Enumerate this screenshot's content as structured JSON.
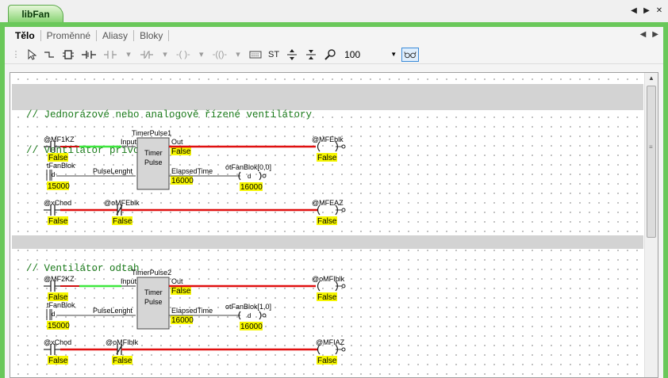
{
  "window": {
    "doc_tab": "libFan",
    "controls": [
      "◀",
      "▶",
      "✕"
    ]
  },
  "subtabs": [
    "Tělo",
    "Proměnné",
    "Aliasy",
    "Bloky"
  ],
  "subtab_arrows": [
    "◀",
    "▶"
  ],
  "toolbar": {
    "st_label": "ST",
    "zoom_value": "100"
  },
  "comments": {
    "block1_line1": "// Jednorázové nebo analogově řízené ventilátory",
    "block1_line2": "// Ventilátor přívodní",
    "block2_line1": "// Ventilátor odtah"
  },
  "rungs": {
    "r1": {
      "block_name": "TimerPulse1",
      "block_type_1": "Timer",
      "block_type_2": "Pulse",
      "in_contact": "@MF1KZ",
      "in_state": "False",
      "pin_input": "Input",
      "pin_pulse": "PulseLenght",
      "pin_out": "Out",
      "pin_elapsed": "ElapsedTime",
      "out_state": "False",
      "elapsed_value": "16000",
      "tfan_var": "tFanBlok",
      "tfan_value": "15000",
      "coil": "@MFEblk",
      "coil_state": "False",
      "otfan_var": "otFanBlok[0,0]",
      "otfan_letter": "d",
      "otfan_value": "16000"
    },
    "r2": {
      "c1": "@xChod",
      "c1_state": "False",
      "c2": "@oMFEblk",
      "c2_state": "False",
      "coil": "@MFEAZ",
      "coil_state": "False"
    },
    "r3": {
      "block_name": "TimerPulse2",
      "block_type_1": "Timer",
      "block_type_2": "Pulse",
      "in_contact": "@MF2KZ",
      "in_state": "False",
      "pin_input": "Input",
      "pin_pulse": "PulseLenght",
      "pin_out": "Out",
      "pin_elapsed": "ElapsedTime",
      "out_state": "False",
      "elapsed_value": "16000",
      "tfan_var": "tFanBlok",
      "tfan_value": "15000",
      "coil": "@oMFIblk",
      "coil_state": "False",
      "otfan_var": "otFanBlok[1,0]",
      "otfan_letter": "d",
      "otfan_value": "16000"
    },
    "r4": {
      "c1": "@xChod",
      "c1_state": "False",
      "c2": "@oMFIblk",
      "c2_state": "False",
      "coil": "@MFIAZ",
      "coil_state": "False"
    }
  },
  "colors": {
    "frame": "#6ac85a",
    "wire_false": "#e01010",
    "wire_true": "#3ee83e",
    "value_bg": "#f6f600",
    "comment_bg": "#d3d3d3",
    "comment_text": "#1a7a1a"
  }
}
